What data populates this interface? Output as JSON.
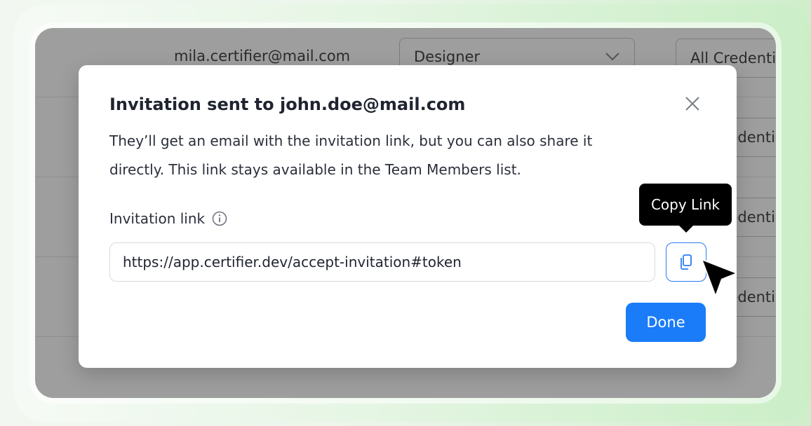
{
  "background_table": {
    "row_email": "mila.certifier@mail.com",
    "role_select_value": "Designer",
    "credential_column_values": [
      "All Credenti",
      "edenti",
      "edenti",
      "edenti"
    ]
  },
  "modal": {
    "title": "Invitation sent to john.doe@mail.com",
    "description": "They’ll get an email with the invitation link, but you can also share it directly. This link stays available in the Team Members list.",
    "field_label": "Invitation link",
    "link_value": "https://app.certifier.dev/accept-invitation#token",
    "tooltip": "Copy Link",
    "done_label": "Done"
  },
  "icons": {
    "close": "close-icon",
    "info": "info-icon",
    "copy": "copy-icon",
    "cursor": "mouse-pointer-icon",
    "chevron": "chevron-down-icon"
  },
  "colors": {
    "primary": "#1a7cf8",
    "copy_border": "#2a7df6",
    "overlay": "#9e9e9e",
    "tooltip_bg": "#000000"
  }
}
